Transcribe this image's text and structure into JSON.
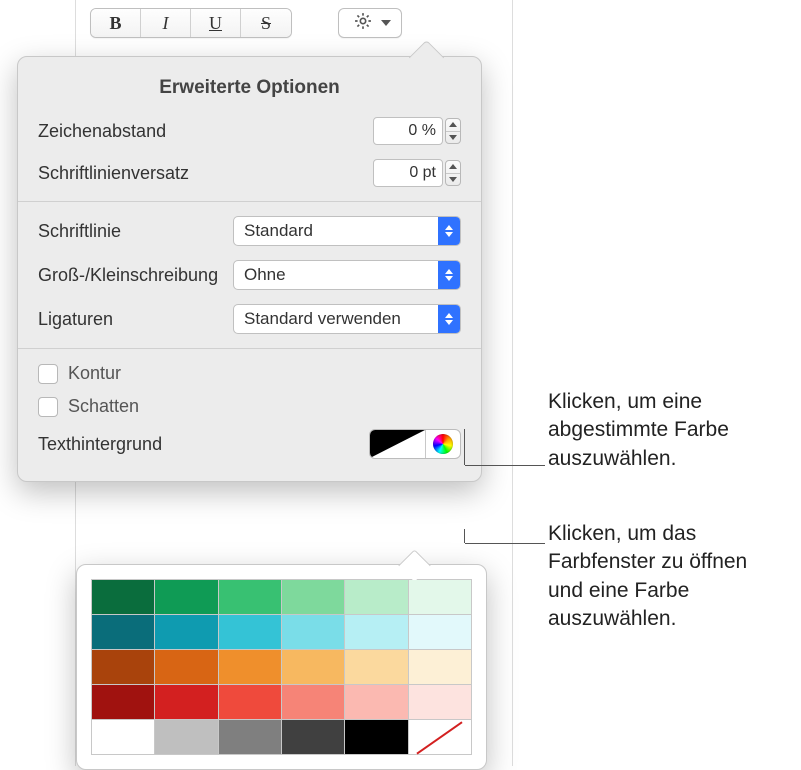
{
  "toolbar": {
    "bold_glyph": "B",
    "italic_glyph": "I",
    "underline_glyph": "U",
    "strike_glyph": "S"
  },
  "popover": {
    "title": "Erweiterte Optionen",
    "tracking_label": "Zeichenabstand",
    "tracking_value": "0 %",
    "baseline_label": "Schriftlinienversatz",
    "baseline_value": "0 pt",
    "linestyle_label": "Schriftlinie",
    "linestyle_value": "Standard",
    "caps_label": "Groß-/Kleinschreibung",
    "caps_value": "Ohne",
    "ligatures_label": "Ligaturen",
    "ligatures_value": "Standard verwenden",
    "outline_label": "Kontur",
    "shadow_label": "Schatten",
    "textbg_label": "Texthintergrund"
  },
  "palette": {
    "rows": [
      [
        "#0a6d3d",
        "#0f9b55",
        "#38c172",
        "#7ed99c",
        "#b8ecc9",
        "#e3f8ea"
      ],
      [
        "#0a6d7a",
        "#0f9bb0",
        "#34c3d6",
        "#7adde8",
        "#b6eff4",
        "#e2f9fb"
      ],
      [
        "#a9430c",
        "#d86514",
        "#ef8f2c",
        "#f7b860",
        "#fbd99e",
        "#fdf0d6"
      ],
      [
        "#a0120f",
        "#d32020",
        "#ef4a3c",
        "#f68477",
        "#fbb9b1",
        "#fde3df"
      ],
      [
        "#ffffff",
        "#bfbfbf",
        "#7f7f7f",
        "#404040",
        "#000000",
        "none"
      ]
    ]
  },
  "callouts": {
    "swatch": "Klicken, um eine abgestimmte Farbe auszuwählen.",
    "picker": "Klicken, um das Farbfenster zu öffnen und eine Farbe auszuwählen."
  }
}
